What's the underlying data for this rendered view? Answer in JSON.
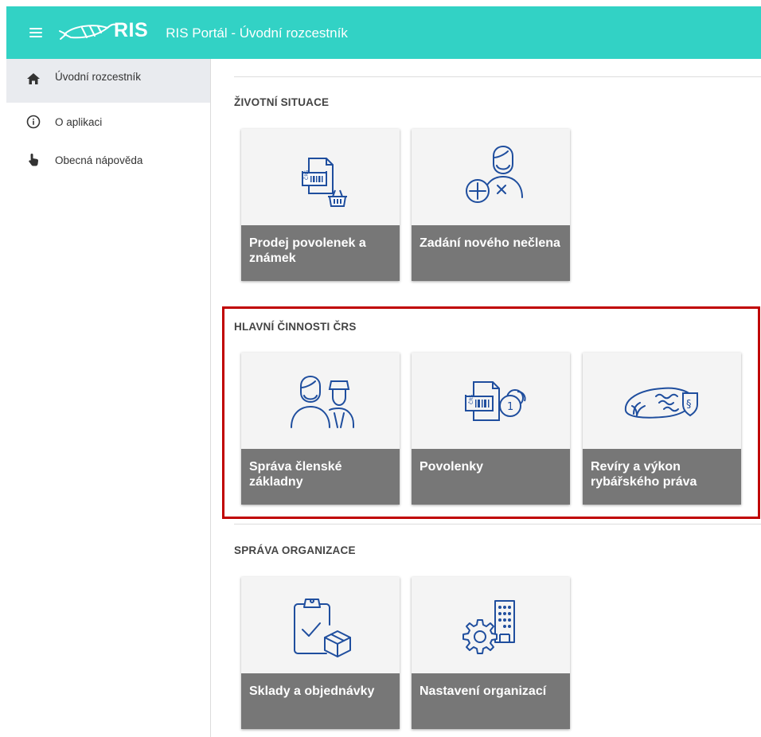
{
  "header": {
    "logo_text": "RIS",
    "title": "RIS Portál - Úvodní rozcestník",
    "background_color": "#32d2c5"
  },
  "sidebar": {
    "items": [
      {
        "label": "Úvodní rozcestník",
        "icon": "home-icon",
        "active": true
      },
      {
        "label": "O aplikaci",
        "icon": "info-icon",
        "active": false
      },
      {
        "label": "Obecná nápověda",
        "icon": "touch-hand-icon",
        "active": false
      }
    ]
  },
  "sections": [
    {
      "title": "ŽIVOTNÍ SITUACE",
      "cards": [
        {
          "label": "Prodej povolenek a známek",
          "icon": "permit-basket-icon"
        },
        {
          "label": "Zadání nového nečlena",
          "icon": "new-nonmember-icon"
        }
      ]
    },
    {
      "title": "HLAVNÍ ČINNOSTI ČRS",
      "highlighted": true,
      "cards": [
        {
          "label": "Správa členské základny",
          "icon": "members-icon"
        },
        {
          "label": "Povolenky",
          "icon": "permit-coins-icon"
        },
        {
          "label": "Revíry a výkon rybářského práva",
          "icon": "fishing-ground-law-icon"
        }
      ]
    },
    {
      "title": "SPRÁVA ORGANIZACE",
      "cards": [
        {
          "label": "Sklady a objednávky",
          "icon": "clipboard-box-icon"
        },
        {
          "label": "Nastavení organizací",
          "icon": "gear-building-icon"
        }
      ]
    }
  ],
  "colors": {
    "card_label_bg": "#777777",
    "icon_blue": "#1f4e9e",
    "highlight_border": "#c00000"
  }
}
